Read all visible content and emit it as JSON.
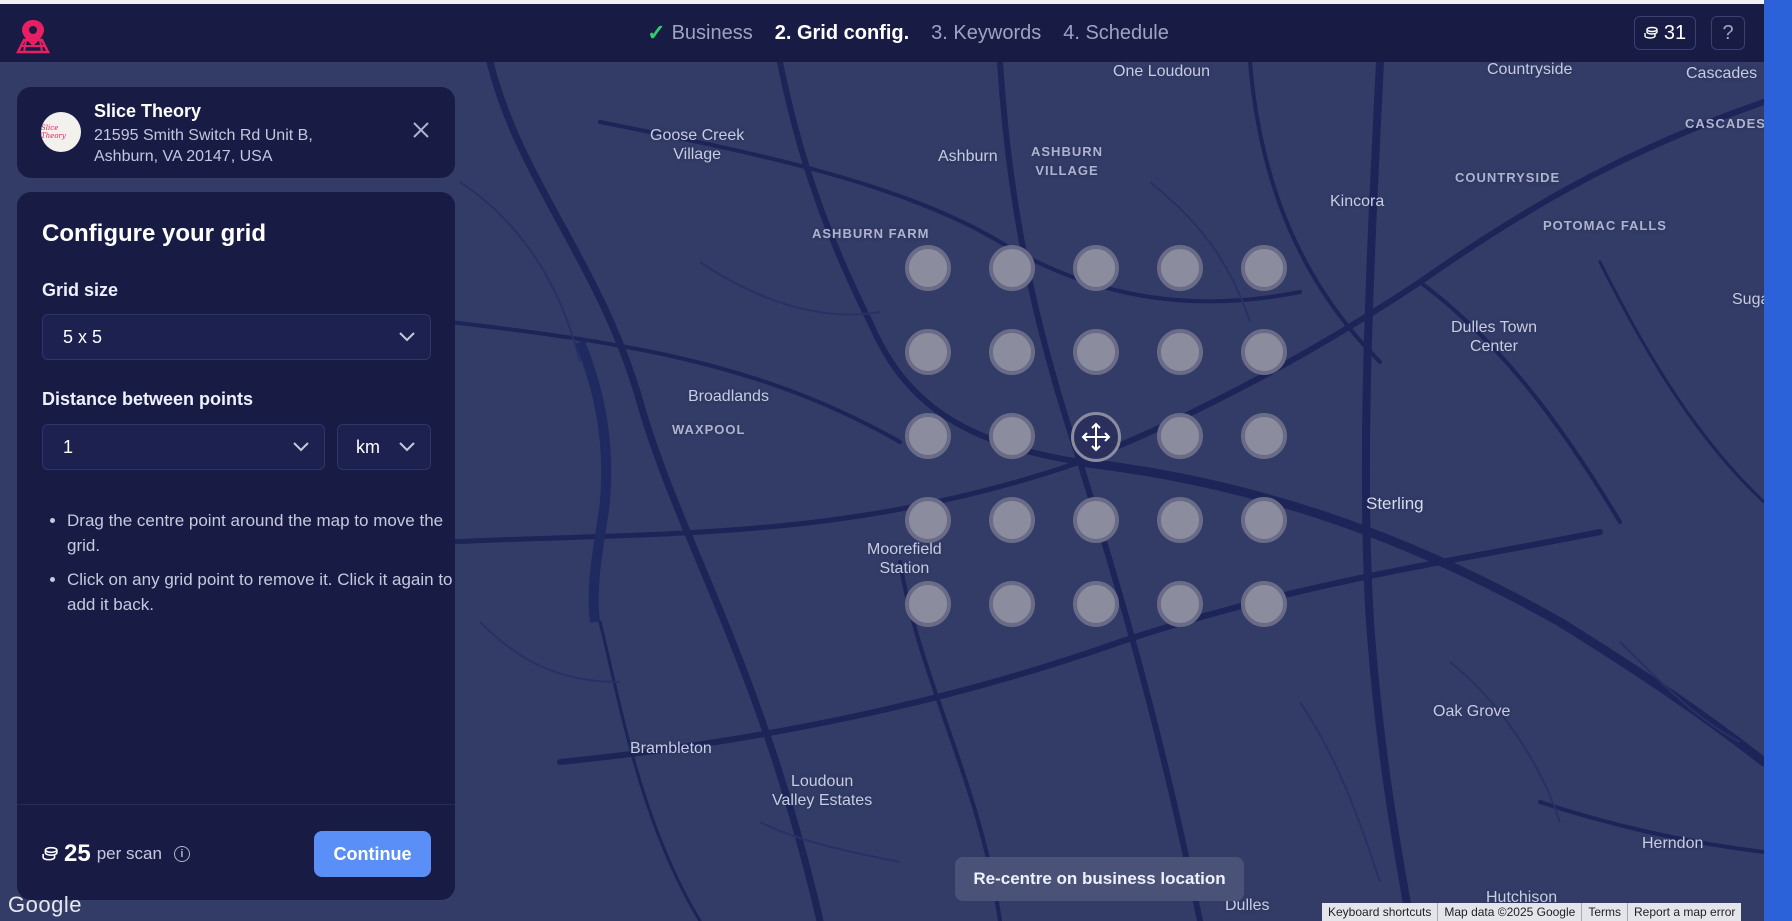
{
  "header": {
    "steps": [
      {
        "label": "Business",
        "done": true
      },
      {
        "label": "2. Grid config.",
        "active": true
      },
      {
        "label": "3. Keywords"
      },
      {
        "label": "4. Schedule"
      }
    ],
    "credits": "31",
    "help": "?"
  },
  "business": {
    "avatar_text": "Slice Theory",
    "name": "Slice Theory",
    "address": "21595 Smith Switch Rd Unit B, Ashburn, VA 20147, USA"
  },
  "panel": {
    "title": "Configure your grid",
    "grid_size_label": "Grid size",
    "grid_size_value": "5 x 5",
    "distance_label": "Distance between points",
    "distance_value": "1",
    "unit_value": "km",
    "hints": [
      "Drag the centre point around the map to move the grid.",
      "Click on any grid point to remove it. Click it again to add it back."
    ],
    "cost_value": "25",
    "cost_suffix": "per scan",
    "continue_label": "Continue"
  },
  "map": {
    "labels": [
      {
        "text": "One Loudoun"
      },
      {
        "text": "Countryside"
      },
      {
        "text": "Cascades"
      },
      {
        "text": "Goose Creek\nVillage"
      },
      {
        "text": "Ashburn"
      },
      {
        "text": "ASHBURN\nVILLAGE"
      },
      {
        "text": "CASCADES"
      },
      {
        "text": "COUNTRYSIDE"
      },
      {
        "text": "Kincora"
      },
      {
        "text": "POTOMAC FALLS"
      },
      {
        "text": "ASHBURN FARM"
      },
      {
        "text": "Dulles Town\nCenter"
      },
      {
        "text": "Suga"
      },
      {
        "text": "Broadlands"
      },
      {
        "text": "WAXPOOL"
      },
      {
        "text": "Sterling"
      },
      {
        "text": "Moorefield\nStation"
      },
      {
        "text": "Oak Grove"
      },
      {
        "text": "Brambleton"
      },
      {
        "text": "Loudoun\nValley Estates"
      },
      {
        "text": "Herndon"
      },
      {
        "text": "Dulles"
      },
      {
        "text": "Hutchison"
      }
    ],
    "recentre_label": "Re-centre on business location",
    "google_logo": "Google",
    "attribution": [
      "Keyboard shortcuts",
      "Map data ©2025 Google",
      "Terms",
      "Report a map error"
    ]
  },
  "grid": {
    "rows": 5,
    "cols": 5
  }
}
